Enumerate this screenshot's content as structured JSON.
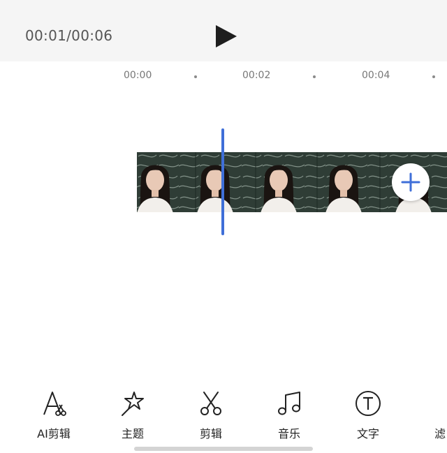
{
  "player": {
    "time_display": "00:01/00:06"
  },
  "ruler": {
    "ticks": [
      "00:00",
      "00:02",
      "00:04"
    ]
  },
  "colors": {
    "playhead": "#3f6fd8",
    "add_icon": "#3f6fd8",
    "topbar_bg": "#f5f5f5",
    "chalkboard": "#2f3d36"
  },
  "toolbar": {
    "ai_edit": "AI剪辑",
    "theme": "主题",
    "edit": "剪辑",
    "music": "音乐",
    "text": "文字",
    "filter": "滤"
  },
  "icons": {
    "play": "play-icon",
    "add": "plus-icon",
    "ai_edit": "ai-edit-icon",
    "theme": "star-wand-icon",
    "edit": "scissors-icon",
    "music": "music-note-icon",
    "text": "text-circle-icon",
    "filter": "filter-icon"
  }
}
